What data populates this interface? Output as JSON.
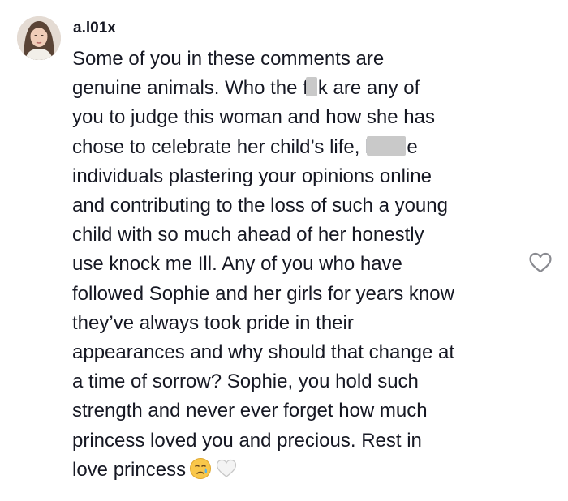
{
  "comment": {
    "username": "a.l01x",
    "avatar_icon": "user-avatar-photo",
    "text_lines": [
      {
        "segments": [
          "Some of you in these comments are"
        ]
      },
      {
        "segments": [
          "genuine animals. Who the f",
          "k are any of"
        ],
        "censored": "fu"
      },
      {
        "segments": [
          "you to judge this woman and how she has"
        ]
      },
      {
        "segments": [
          "chose to celebrate her child’s life, l",
          "e"
        ],
        "censored": "lo"
      },
      {
        "segments": [
          "individuals plastering your opinions online"
        ]
      },
      {
        "segments": [
          "and contributing to the loss of such a young"
        ]
      },
      {
        "segments": [
          "child with so much ahead of her honestly"
        ]
      },
      {
        "segments": [
          "use knock me Ill. Any of you who have"
        ]
      },
      {
        "segments": [
          "followed Sophie and her girls for years know"
        ]
      },
      {
        "segments": [
          "they’ve always took pride in their"
        ]
      },
      {
        "segments": [
          "appearances and why should that change at"
        ]
      },
      {
        "segments": [
          "a time of sorrow? Sophie, you hold such"
        ]
      },
      {
        "segments": [
          "strength and never ever forget how much"
        ]
      },
      {
        "segments": [
          "princess loved you and precious. Rest in"
        ]
      },
      {
        "segments": [
          "love princess"
        ]
      }
    ],
    "emojis": [
      "crying-face-emoji",
      "white-heart-emoji"
    ],
    "like_icon": "heart-outline-icon"
  },
  "colors": {
    "text": "#161823",
    "icon": "#8a8b91",
    "censor": "#c9c9c9"
  }
}
